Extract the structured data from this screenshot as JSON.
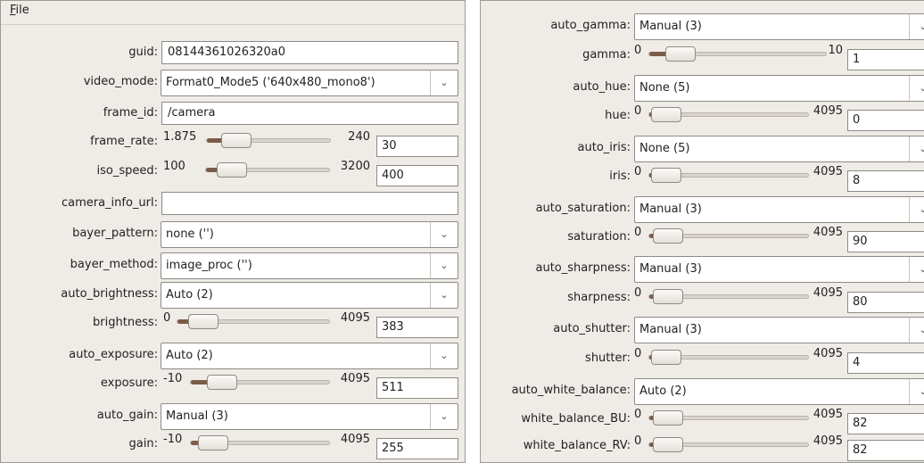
{
  "menu": {
    "file_label": "File",
    "file_mnemonic": "F",
    "file_rest": "ile"
  },
  "left": {
    "guid": {
      "label": "guid:",
      "value": "08144361026320a0"
    },
    "video_mode": {
      "label": "video_mode:",
      "value": "Format0_Mode5 ('640x480_mono8')"
    },
    "frame_id": {
      "label": "frame_id:",
      "value": "/camera"
    },
    "frame_rate": {
      "label": "frame_rate:",
      "min": "1.875",
      "max": "240",
      "value": "30"
    },
    "iso_speed": {
      "label": "iso_speed:",
      "min": "100",
      "max": "3200",
      "value": "400"
    },
    "camera_info_url": {
      "label": "camera_info_url:",
      "value": ""
    },
    "bayer_pattern": {
      "label": "bayer_pattern:",
      "value": "none ('')"
    },
    "bayer_method": {
      "label": "bayer_method:",
      "value": "image_proc ('')"
    },
    "auto_brightness": {
      "label": "auto_brightness:",
      "value": "Auto (2)"
    },
    "brightness": {
      "label": "brightness:",
      "min": "0",
      "max": "4095",
      "value": "383"
    },
    "auto_exposure": {
      "label": "auto_exposure:",
      "value": "Auto (2)"
    },
    "exposure": {
      "label": "exposure:",
      "min": "-10",
      "max": "4095",
      "value": "511"
    },
    "auto_gain": {
      "label": "auto_gain:",
      "value": "Manual (3)"
    },
    "gain": {
      "label": "gain:",
      "min": "-10",
      "max": "4095",
      "value": "255"
    }
  },
  "right": {
    "auto_gamma": {
      "label": "auto_gamma:",
      "value": "Manual (3)"
    },
    "gamma": {
      "label": "gamma:",
      "min": "0",
      "max": "10",
      "value": "1"
    },
    "auto_hue": {
      "label": "auto_hue:",
      "value": "None (5)"
    },
    "hue": {
      "label": "hue:",
      "min": "0",
      "max": "4095",
      "value": "0"
    },
    "auto_iris": {
      "label": "auto_iris:",
      "value": "None (5)"
    },
    "iris": {
      "label": "iris:",
      "min": "0",
      "max": "4095",
      "value": "8"
    },
    "auto_saturation": {
      "label": "auto_saturation:",
      "value": "Manual (3)"
    },
    "saturation": {
      "label": "saturation:",
      "min": "0",
      "max": "4095",
      "value": "90"
    },
    "auto_sharpness": {
      "label": "auto_sharpness:",
      "value": "Manual (3)"
    },
    "sharpness": {
      "label": "sharpness:",
      "min": "0",
      "max": "4095",
      "value": "80"
    },
    "auto_shutter": {
      "label": "auto_shutter:",
      "value": "Manual (3)"
    },
    "shutter": {
      "label": "shutter:",
      "min": "0",
      "max": "4095",
      "value": "4"
    },
    "auto_white_balance": {
      "label": "auto_white_balance:",
      "value": "Auto (2)"
    },
    "white_balance_BU": {
      "label": "white_balance_BU:",
      "min": "0",
      "max": "4095",
      "value": "82"
    },
    "white_balance_RV": {
      "label": "white_balance_RV:",
      "min": "0",
      "max": "4095",
      "value": "82"
    }
  },
  "icons": {
    "dropdown": "chevron-down-icon"
  },
  "colors": {
    "panel_bg": "#efebe6",
    "slider_fill": "#7a5c49",
    "border": "#8e8a84"
  }
}
